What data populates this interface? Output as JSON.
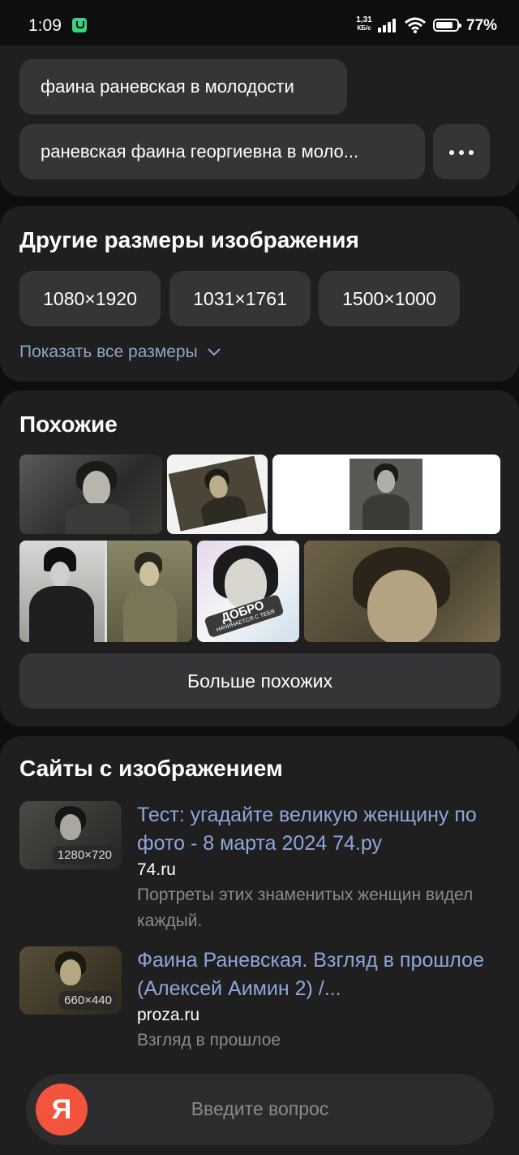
{
  "status": {
    "time": "1:09",
    "net_speed_value": "1,31",
    "net_speed_unit": "КБ/с",
    "battery": "77%"
  },
  "suggestions": {
    "items": [
      "фаина раневская в молодости",
      "раневская фаина георгиевна в моло..."
    ],
    "more_icon": "ellipsis-icon"
  },
  "sizes": {
    "title": "Другие размеры изображения",
    "chips": [
      "1080×1920",
      "1031×1761",
      "1500×1000"
    ],
    "show_all": "Показать все размеры"
  },
  "similar": {
    "title": "Похожие",
    "overlay_text_1": "ДОБРО",
    "overlay_text_2": "НАЧИНАЕТСЯ С ТЕБЯ",
    "more_button": "Больше похожих"
  },
  "sites": {
    "title": "Сайты с изображением",
    "results": [
      {
        "size": "1280×720",
        "title": "Тест: угадайте великую женщину по фото - 8 марта 2024 74.ру",
        "domain": "74.ru",
        "desc": "Портреты этих знаменитых женщин видел каждый."
      },
      {
        "size": "660×440",
        "title": "Фаина Раневская. Взгляд в прошлое (Алексей Аимин 2) /...",
        "domain": "proza.ru",
        "desc": "Взгляд в прошлое"
      }
    ]
  },
  "assistant": {
    "logo": "Я",
    "placeholder": "Введите вопрос"
  },
  "colors": {
    "background": "#0e0e0e",
    "card": "#1f1f20",
    "chip": "#353537",
    "link": "#8ea6d8",
    "brand": "#f4533d"
  }
}
